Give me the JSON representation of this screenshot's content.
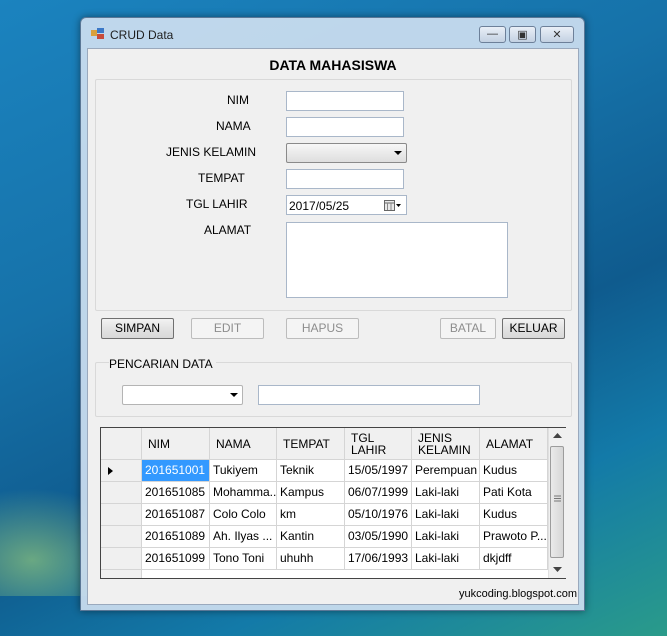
{
  "window": {
    "title": "CRUD Data"
  },
  "form": {
    "heading": "DATA MAHASISWA",
    "labels": {
      "nim": "NIM",
      "nama": "NAMA",
      "jenis_kelamin": "JENIS KELAMIN",
      "tempat": "TEMPAT",
      "tgl_lahir": "TGL LAHIR",
      "alamat": "ALAMAT"
    },
    "values": {
      "nim": "",
      "nama": "",
      "jenis_kelamin": "",
      "tempat": "",
      "tgl_lahir": "2017/05/25",
      "alamat": ""
    }
  },
  "buttons": {
    "simpan": "SIMPAN",
    "edit": "EDIT",
    "hapus": "HAPUS",
    "batal": "BATAL",
    "keluar": "KELUAR"
  },
  "search": {
    "label": "PENCARIAN DATA",
    "field_value": "",
    "query": ""
  },
  "table": {
    "columns": [
      "NIM",
      "NAMA",
      "TEMPAT",
      "TGL LAHIR",
      "JENIS KELAMIN",
      "ALAMAT"
    ],
    "rows": [
      [
        "201651001",
        "Tukiyem",
        "Teknik",
        "15/05/1997",
        "Perempuan",
        "Kudus"
      ],
      [
        "201651085",
        "Mohamma...",
        "Kampus",
        "06/07/1999",
        "Laki-laki",
        "Pati Kota"
      ],
      [
        "201651087",
        "Colo Colo",
        "km",
        "05/10/1976",
        "Laki-laki",
        "Kudus"
      ],
      [
        "201651089",
        "Ah. Ilyas ...",
        "Kantin",
        "03/05/1990",
        "Laki-laki",
        "Prawoto P..."
      ],
      [
        "201651099",
        "Tono Toni",
        "uhuhh",
        "17/06/1993",
        "Laki-laki",
        "dkjdff"
      ]
    ],
    "selected_row": 0
  },
  "footer": {
    "credit": "yukcoding.blogspot.com"
  },
  "colors": {
    "selection": "#3399ff",
    "desktop": "#1672a9"
  }
}
